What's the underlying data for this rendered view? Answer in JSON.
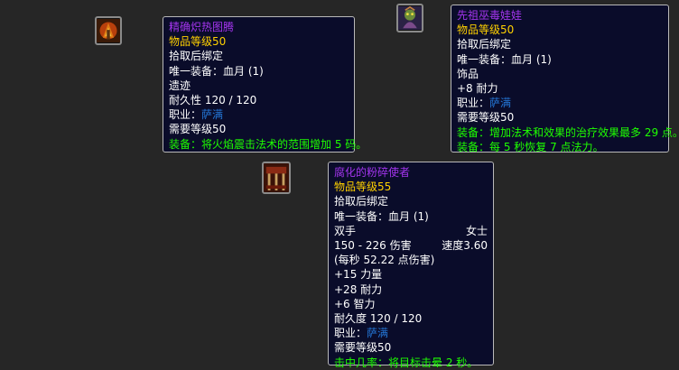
{
  "items": [
    {
      "icon": "fire-totem-icon",
      "name": "精确炽热图腾",
      "item_level": "物品等级50",
      "bind": "拾取后绑定",
      "unique": "唯一装备：血月 (1)",
      "slot": "遗迹",
      "durability": "耐久性 120 / 120",
      "class_label": "职业：",
      "class_value": "萨满",
      "req_level": "需要等级50",
      "equip": "装备：将火焰震击法术的范围增加 5 码。"
    },
    {
      "icon": "witch-doll-icon",
      "name": "先祖巫毒娃娃",
      "item_level": "物品等级50",
      "bind": "拾取后绑定",
      "unique": "唯一装备：血月 (1)",
      "slot": "饰品",
      "stat": "+8 耐力",
      "class_label": "职业：",
      "class_value": "萨满",
      "req_level": "需要等级50",
      "equip1": "装备：增加法术和效果的治疗效果最多 29 点。",
      "equip2": "装备：每 5 秒恢复 7 点法力。"
    },
    {
      "icon": "pulverizer-icon",
      "name": "腐化的粉碎使者",
      "item_level": "物品等级55",
      "bind": "拾取后绑定",
      "unique": "唯一装备：血月 (1)",
      "hand": "双手",
      "type": "女士",
      "damage": "150 - 226 伤害",
      "speed": "速度3.60",
      "dps": "(每秒 52.22 点伤害)",
      "stat1": "+15 力量",
      "stat2": "+28 耐力",
      "stat3": "+6 智力",
      "durability": "耐久度 120 / 120",
      "class_label": "职业：",
      "class_value": "萨满",
      "req_level": "需要等级50",
      "chance": "击中几率：将目标击晕 2 秒。"
    }
  ],
  "colors": {
    "epic_purple": "#a335ee",
    "item_level_gold": "#ffd100",
    "shaman_blue": "#2476d6",
    "equip_green": "#1eff00",
    "tooltip_bg": "#0a0c2a"
  }
}
